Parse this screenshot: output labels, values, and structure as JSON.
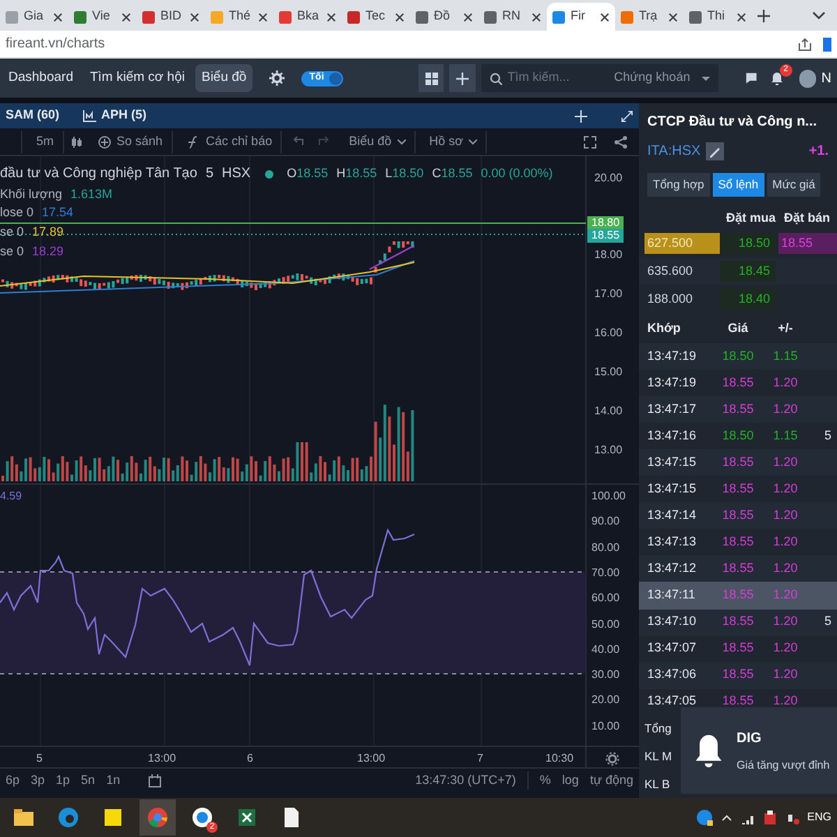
{
  "browser": {
    "tabs": [
      {
        "title": "Gia",
        "selected": false
      },
      {
        "title": "Vie",
        "selected": false
      },
      {
        "title": "BID",
        "selected": false
      },
      {
        "title": "Thé",
        "selected": false
      },
      {
        "title": "Bka",
        "selected": false
      },
      {
        "title": "Tec",
        "selected": false
      },
      {
        "title": "Đồ",
        "selected": false
      },
      {
        "title": "RN",
        "selected": false
      },
      {
        "title": "Fir",
        "selected": true
      },
      {
        "title": "Trạ",
        "selected": false
      },
      {
        "title": "Thi",
        "selected": false
      }
    ],
    "address": "fireant.vn/charts"
  },
  "nav": {
    "items": [
      {
        "label": "Dashboard",
        "selected": false
      },
      {
        "label": "Tìm kiếm cơ hội",
        "selected": false
      },
      {
        "label": "Biểu đồ",
        "selected": true
      }
    ],
    "theme_toggle": {
      "label": "Tối",
      "on": true
    },
    "search": {
      "placeholder": "Tìm kiếm...",
      "category": "Chứng khoán"
    },
    "notification_count": "2",
    "user_initial": "N"
  },
  "chart_tabs": [
    "SAM (60)",
    "APH (5)"
  ],
  "toolbar": {
    "interval": "5m",
    "compare": "So sánh",
    "indicators": "Các chỉ báo",
    "chart_type": "Biểu đồ",
    "profile": "Hồ sơ"
  },
  "legend": {
    "title": "đầu tư và Công nghiệp Tân Tạo",
    "interval": "5",
    "exchange": "HSX",
    "ohlc": [
      {
        "label": "O",
        "value": "18.55"
      },
      {
        "label": "H",
        "value": "18.55"
      },
      {
        "label": "L",
        "value": "18.50"
      },
      {
        "label": "C",
        "value": "18.55"
      }
    ],
    "change": "0.00 (0.00%)",
    "volume_label": "Khối lượng",
    "volume": "1.613M",
    "ma": [
      {
        "label": "lose 0",
        "value": "17.54",
        "color": "#2f7fd0"
      },
      {
        "label": "se 0",
        "value": "17.89",
        "color": "#e6c229"
      },
      {
        "label": "se 0",
        "value": "18.29",
        "color": "#9c3fd0"
      }
    ]
  },
  "price_axis": [
    "20.00",
    "18.00",
    "17.00",
    "16.00",
    "15.00",
    "14.00",
    "13.00"
  ],
  "price_badges": [
    {
      "value": "18.80",
      "color": "#4caf50"
    },
    {
      "value": "18.55",
      "color": "#26a69a"
    }
  ],
  "rsi": {
    "value": "4.59",
    "axis": [
      "100.00",
      "90.00",
      "80.00",
      "70.00",
      "60.00",
      "50.00",
      "40.00",
      "30.00",
      "20.00",
      "10.00"
    ]
  },
  "time_axis": [
    "5",
    "13:00",
    "6",
    "13:00",
    "7",
    "10:30"
  ],
  "ranges": [
    "6p",
    "3p",
    "1p",
    "5n",
    "1n"
  ],
  "clock": "13:47:30 (UTC+7)",
  "scale_options": [
    "%",
    "log",
    "tự động"
  ],
  "panel": {
    "company": "CTCP Đầu tư và Công n...",
    "symbol": "ITA:HSX",
    "change": "+1.",
    "tabs": [
      {
        "label": "Tổng hợp",
        "selected": false
      },
      {
        "label": "Sổ lệnh",
        "selected": true
      },
      {
        "label": "Mức giá",
        "selected": false
      }
    ],
    "order_headers": [
      "Đặt mua",
      "Đặt bán"
    ],
    "orders": [
      {
        "volume": "627.500",
        "highlight": true,
        "bid": "18.50",
        "ask": "18.55"
      },
      {
        "volume": "635.600",
        "highlight": false,
        "bid": "18.45"
      },
      {
        "volume": "188.000",
        "highlight": false,
        "bid": "18.40"
      }
    ],
    "trade_headers": [
      "Khớp",
      "Giá",
      "+/-"
    ],
    "trades": [
      {
        "time": "13:47:19",
        "price": "18.50",
        "change": "1.15",
        "color": "#22b422",
        "selected": false
      },
      {
        "time": "13:47:19",
        "price": "18.55",
        "change": "1.20",
        "color": "#d83cd8",
        "selected": false
      },
      {
        "time": "13:47:17",
        "price": "18.55",
        "change": "1.20",
        "color": "#d83cd8",
        "selected": false
      },
      {
        "time": "13:47:16",
        "price": "18.50",
        "change": "1.15",
        "color": "#22b422",
        "volume": "5",
        "selected": false
      },
      {
        "time": "13:47:15",
        "price": "18.55",
        "change": "1.20",
        "color": "#d83cd8",
        "selected": false
      },
      {
        "time": "13:47:15",
        "price": "18.55",
        "change": "1.20",
        "color": "#d83cd8",
        "selected": false
      },
      {
        "time": "13:47:14",
        "price": "18.55",
        "change": "1.20",
        "color": "#d83cd8",
        "selected": false
      },
      {
        "time": "13:47:13",
        "price": "18.55",
        "change": "1.20",
        "color": "#d83cd8",
        "selected": false
      },
      {
        "time": "13:47:12",
        "price": "18.55",
        "change": "1.20",
        "color": "#d83cd8",
        "selected": false
      },
      {
        "time": "13:47:11",
        "price": "18.55",
        "change": "1.20",
        "color": "#d83cd8",
        "selected": true
      },
      {
        "time": "13:47:10",
        "price": "18.55",
        "change": "1.20",
        "color": "#d83cd8",
        "volume": "5",
        "selected": false
      },
      {
        "time": "13:47:07",
        "price": "18.55",
        "change": "1.20",
        "color": "#d83cd8",
        "selected": false
      },
      {
        "time": "13:47:06",
        "price": "18.55",
        "change": "1.20",
        "color": "#d83cd8",
        "selected": false
      },
      {
        "time": "13:47:05",
        "price": "18.55",
        "change": "1.20",
        "color": "#d83cd8",
        "selected": false
      }
    ],
    "summary": [
      "Tổng",
      "KL M",
      "KL B"
    ]
  },
  "notification": {
    "title": "DIG",
    "message": "Giá tăng vượt đỉnh"
  },
  "taskbar": {
    "chat_badge": "2",
    "language": "ENG"
  }
}
